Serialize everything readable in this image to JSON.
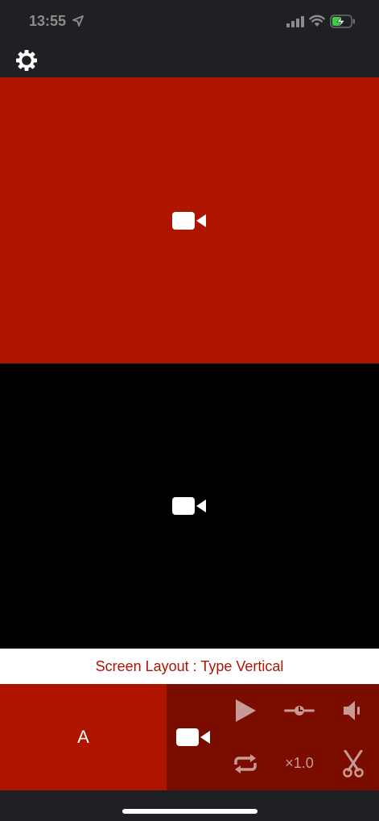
{
  "status_bar": {
    "time": "13:55",
    "icons": [
      "location-arrow-icon",
      "cellular-signal-icon",
      "wifi-icon",
      "battery-charging-icon"
    ]
  },
  "toolbar": {
    "icon": "gear-icon"
  },
  "panes": [
    {
      "name": "video-pane-a",
      "color": "#ad1500",
      "icon": "video-camera-icon"
    },
    {
      "name": "video-pane-b",
      "color": "#000000",
      "icon": "video-camera-icon"
    }
  ],
  "layout_label": "Screen Layout : Type Vertical",
  "controls": {
    "select_label": "A",
    "speed_label": "×1.0",
    "icons": [
      "video-camera-icon",
      "play-icon",
      "slider-icon",
      "volume-icon",
      "loop-icon",
      "scissors-icon"
    ]
  },
  "colors": {
    "accent": "#ad1500",
    "controls_bg": "#7a0d00",
    "chrome_bg": "#1f2023",
    "icon_dim": "#c79a95"
  }
}
